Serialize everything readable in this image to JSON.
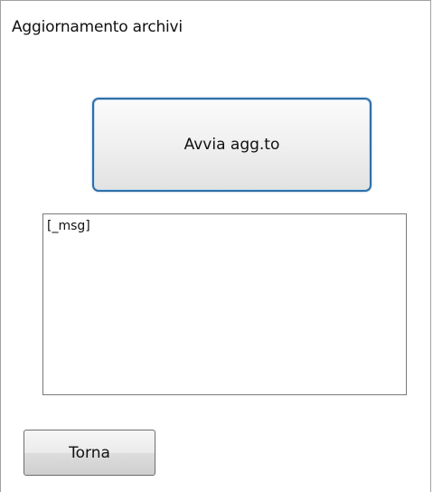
{
  "window": {
    "title": "Aggiornamento archivi"
  },
  "actions": {
    "start_label": "Avvia agg.to",
    "back_label": "Torna"
  },
  "message_box": {
    "text": "[_msg]"
  },
  "colors": {
    "accent_border": "#2f6fa8",
    "background": "#ffffff"
  }
}
